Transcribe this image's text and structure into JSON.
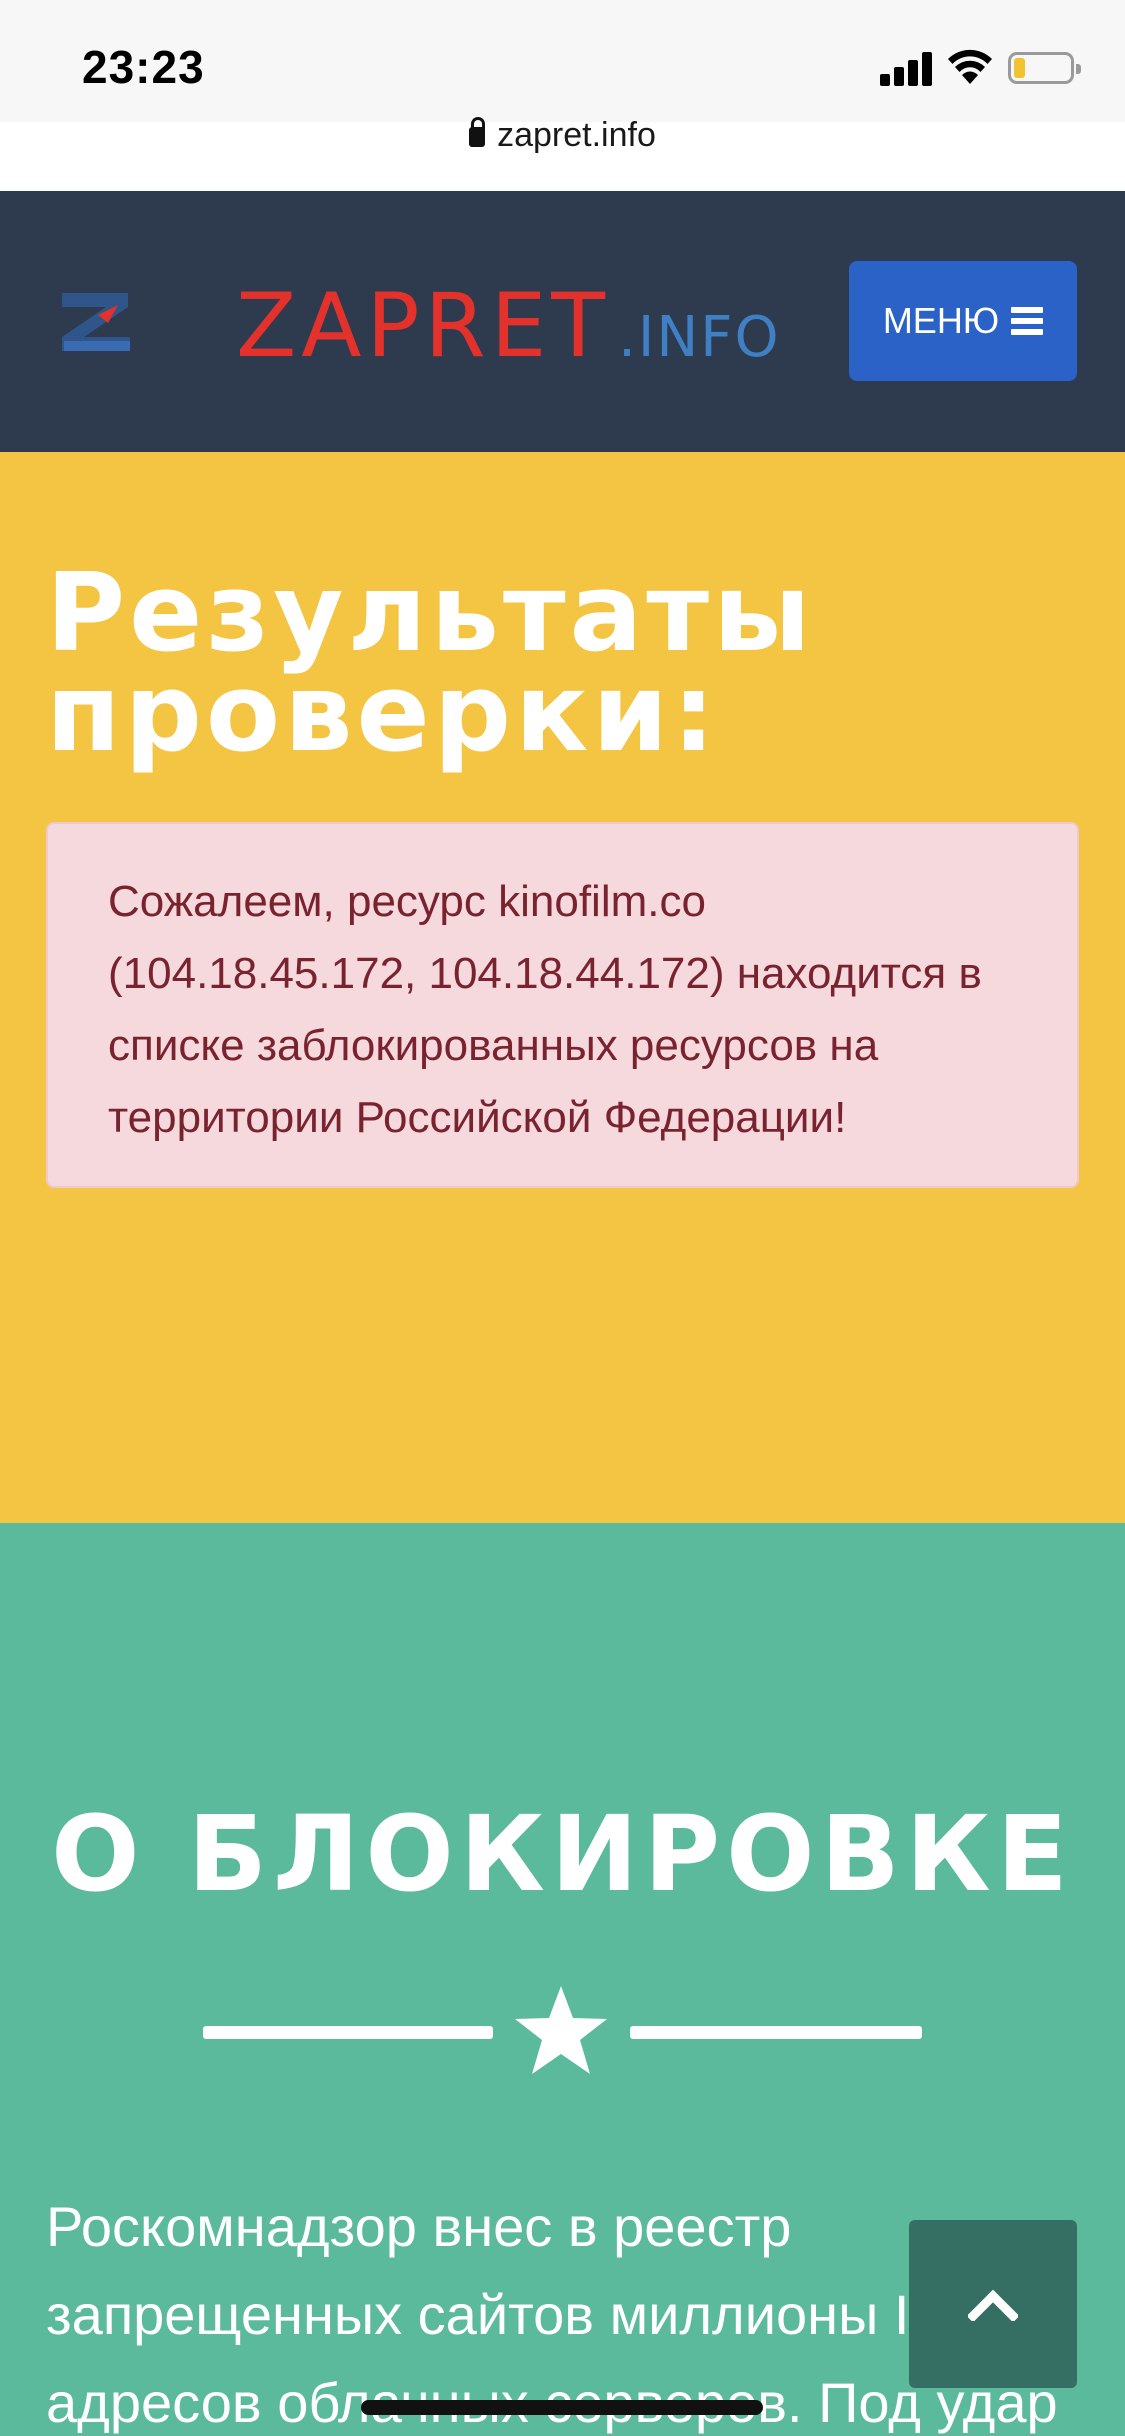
{
  "status_bar": {
    "time": "23:23",
    "url": "zapret.info",
    "battery_level": 0.2
  },
  "header": {
    "brand_main": "ZAPRET",
    "brand_sub": ".INFO",
    "menu_label": "МЕНЮ",
    "logo_icon": "z-logo-icon"
  },
  "results": {
    "title": "Результаты проверки:",
    "alert_text": "Сожалеем, ресурс kinofilm.co (104.18.45.172, 104.18.44.172) находится в списке заблокированных ресурсов на территории Российской Федерации!"
  },
  "about": {
    "title": "О БЛОКИРОВКЕ",
    "divider_icon": "star-icon",
    "body_text": "Роскомнадзор внес в реестр запрещенных сайтов миллионы IP-адресов облачных серверов. Под удар"
  },
  "colors": {
    "header_bg": "#2e3a4e",
    "brand_red": "#e2322b",
    "brand_blue": "#3f7fc4",
    "menu_button": "#2a62c7",
    "results_bg": "#f4c443",
    "alert_bg": "#f5d9dd",
    "alert_text": "#7a2330",
    "about_bg": "#5bb99c",
    "back_top_bg": "#356e62"
  },
  "back_to_top_icon": "chevron-up-icon"
}
